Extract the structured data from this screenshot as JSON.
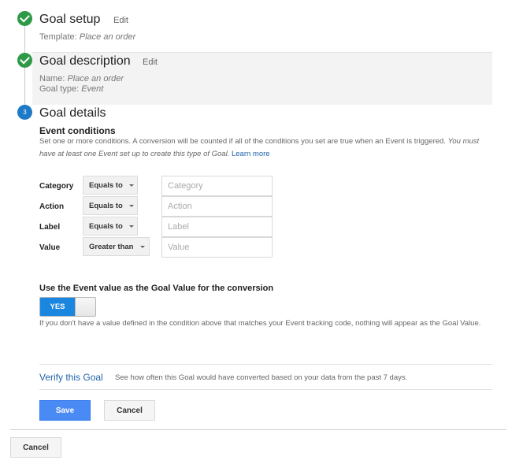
{
  "steps": [
    {
      "status": "complete",
      "icon": "check-icon",
      "title": "Goal setup",
      "edit_label": "Edit",
      "details": [
        {
          "label": "Template: ",
          "value": "Place an order"
        }
      ]
    },
    {
      "status": "complete",
      "icon": "check-icon",
      "title": "Goal description",
      "edit_label": "Edit",
      "details": [
        {
          "label": "Name: ",
          "value": "Place an order"
        },
        {
          "label": "Goal type: ",
          "value": "Event"
        }
      ]
    },
    {
      "status": "current",
      "number": "3",
      "title": "Goal details"
    }
  ],
  "event_conditions": {
    "heading": "Event conditions",
    "help_text": "Set one or more conditions. A conversion will be counted if all of the conditions you set are true when an Event is triggered. ",
    "help_italic": "You must have at least one Event set up to create this type of Goal.",
    "learn_more": "Learn more",
    "rows": [
      {
        "label": "Category",
        "operator": "Equals to",
        "placeholder": "Category",
        "value": ""
      },
      {
        "label": "Action",
        "operator": "Equals to",
        "placeholder": "Action",
        "value": ""
      },
      {
        "label": "Label",
        "operator": "Equals to",
        "placeholder": "Label",
        "value": ""
      },
      {
        "label": "Value",
        "operator": "Greater than",
        "placeholder": "Value",
        "value": ""
      }
    ]
  },
  "goal_value": {
    "heading": "Use the Event value as the Goal Value for the conversion",
    "toggle_label": "YES",
    "toggle_on": true,
    "help_text": "If you don't have a value defined in the condition above that matches your Event tracking code, nothing will appear as the Goal Value."
  },
  "verify": {
    "link": "Verify this Goal",
    "text": "See how often this Goal would have converted based on your data from the past 7 days."
  },
  "actions": {
    "save": "Save",
    "cancel": "Cancel"
  },
  "footer": {
    "cancel": "Cancel"
  },
  "colors": {
    "complete": "#2e9a47",
    "current": "#1d7ac9",
    "primary": "#4a8af4",
    "link": "#1f62a8"
  }
}
